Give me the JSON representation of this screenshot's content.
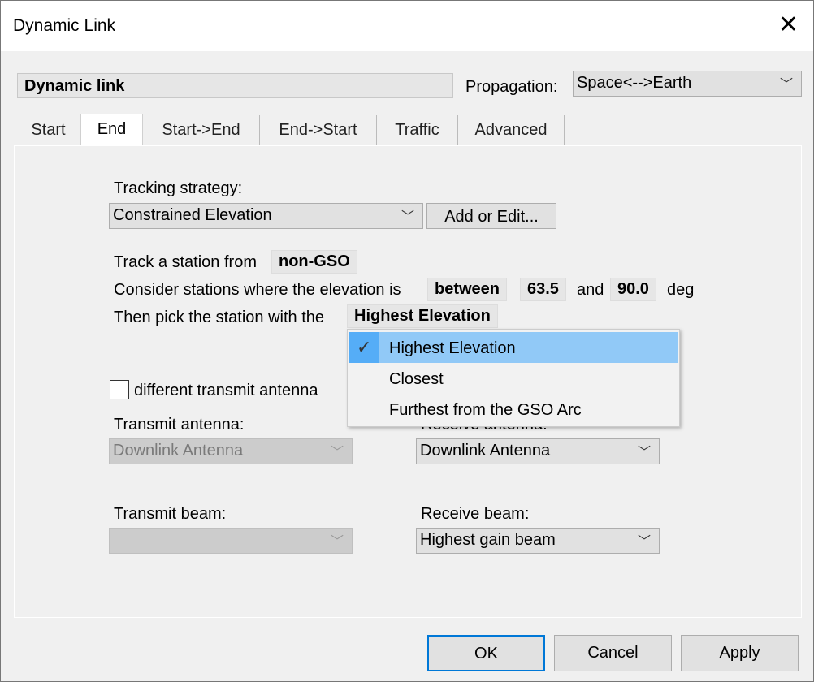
{
  "window": {
    "title": "Dynamic Link",
    "close_icon": "close-icon"
  },
  "header": {
    "name": "Dynamic link",
    "propagation_label": "Propagation:",
    "propagation_value": "Space<-->Earth"
  },
  "tabs": [
    {
      "label": "Start"
    },
    {
      "label": "End",
      "selected": true
    },
    {
      "label": "Start->End"
    },
    {
      "label": "End->Start"
    },
    {
      "label": "Traffic"
    },
    {
      "label": "Advanced"
    }
  ],
  "end": {
    "tracking_label": "Tracking strategy:",
    "tracking_value": "Constrained Elevation",
    "add_edit": "Add or Edit...",
    "track_from_text": "Track a station from",
    "track_from_value": "non-GSO",
    "consider_text": "Consider stations where the elevation is",
    "range_mode": "between",
    "min": "63.5",
    "and_text": "and",
    "max": "90.0",
    "unit": "deg",
    "pick_text": "Then pick the station with the",
    "pick_value": "Highest Elevation",
    "pick_options": [
      {
        "label": "Highest Elevation",
        "checked": true
      },
      {
        "label": "Closest"
      },
      {
        "label": "Furthest from the GSO Arc"
      }
    ],
    "diff_tx_label": "different transmit antenna",
    "diff_tx_checked": false,
    "tx_antenna_label": "Transmit antenna:",
    "tx_antenna_value": "Downlink Antenna",
    "rx_antenna_label": "Receive antenna:",
    "rx_antenna_value": "Downlink Antenna",
    "tx_beam_label": "Transmit beam:",
    "tx_beam_value": "",
    "rx_beam_label": "Receive beam:",
    "rx_beam_value": "Highest gain beam"
  },
  "buttons": {
    "ok": "OK",
    "cancel": "Cancel",
    "apply": "Apply"
  },
  "colors": {
    "default_button_border": "#0078d7",
    "menu_highlight": "#91c9f7",
    "check_background": "#55adf7"
  }
}
